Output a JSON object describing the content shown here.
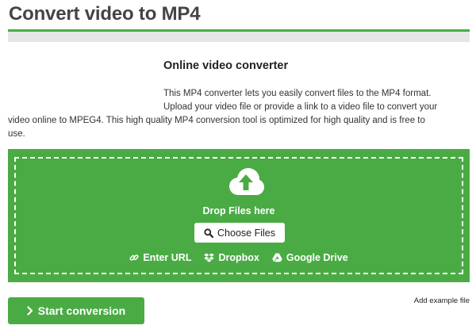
{
  "page": {
    "title": "Convert video to MP4"
  },
  "converter": {
    "heading": "Online video converter",
    "intro_lines": [
      "This MP4 converter lets you easily convert files to the MP4 format.",
      "Upload your video file or provide a link to a video file to convert your",
      "video online to MPEG4. This high quality MP4 conversion tool is optimized for high quality and is free to",
      "use."
    ]
  },
  "dropzone": {
    "label": "Drop Files here",
    "choose_label": "Choose Files",
    "upload_icon": "cloud-upload-icon",
    "sources": [
      {
        "label": "Enter URL",
        "icon": "link-icon"
      },
      {
        "label": "Dropbox",
        "icon": "dropbox-icon"
      },
      {
        "label": "Google Drive",
        "icon": "google-drive-icon"
      }
    ]
  },
  "actions": {
    "start_label": "Start conversion",
    "example_label": "Add example file"
  },
  "colors": {
    "accent": "#4aab45",
    "title_bar": "#e6e6e6",
    "text": "#333333"
  }
}
